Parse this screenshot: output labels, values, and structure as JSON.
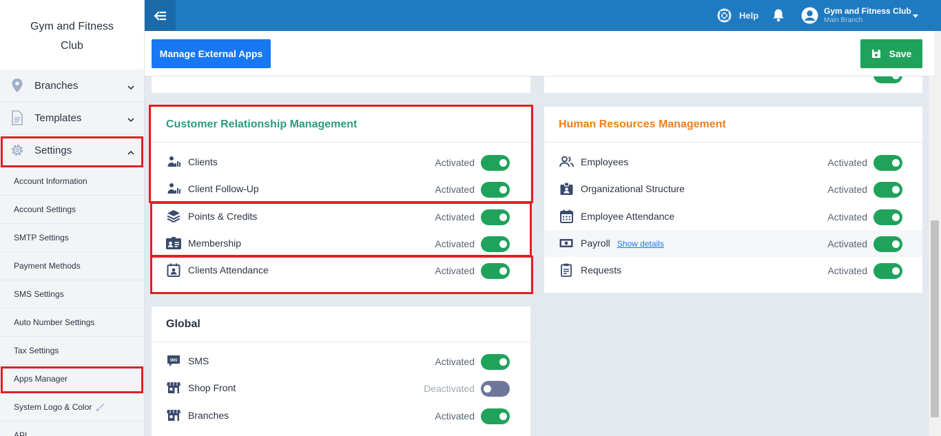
{
  "sidebar": {
    "brand": "Gym and Fitness Club",
    "nav": [
      {
        "label": "Branches"
      },
      {
        "label": "Templates"
      },
      {
        "label": "Settings"
      }
    ],
    "settings_items": [
      {
        "label": "Account Information"
      },
      {
        "label": "Account Settings"
      },
      {
        "label": "SMTP Settings"
      },
      {
        "label": "Payment Methods"
      },
      {
        "label": "SMS Settings"
      },
      {
        "label": "Auto Number Settings"
      },
      {
        "label": "Tax Settings"
      },
      {
        "label": "Apps Manager"
      },
      {
        "label": "System Logo & Color"
      },
      {
        "label": "API"
      }
    ]
  },
  "topbar": {
    "help_label": "Help",
    "user_name": "Gym and Fitness Club",
    "user_branch": "Main Branch"
  },
  "actions": {
    "manage_label": "Manage External Apps",
    "save_label": "Save"
  },
  "crm": {
    "title": "Customer Relationship Management",
    "title_color": "#2a9d7c",
    "rows": [
      {
        "label": "Clients",
        "status": "Activated",
        "icon": "client-stats-icon"
      },
      {
        "label": "Client Follow-Up",
        "status": "Activated",
        "icon": "client-stats-icon"
      },
      {
        "label": "Points & Credits",
        "status": "Activated",
        "icon": "layers-icon"
      },
      {
        "label": "Membership",
        "status": "Activated",
        "icon": "id-card-icon"
      },
      {
        "label": "Clients Attendance",
        "status": "Activated",
        "icon": "calendar-user-icon"
      }
    ]
  },
  "hr": {
    "title": "Human Resources Management",
    "title_color": "#f07f1a",
    "rows": [
      {
        "label": "Employees",
        "status": "Activated",
        "icon": "users-icon"
      },
      {
        "label": "Organizational Structure",
        "status": "Activated",
        "icon": "badge-icon"
      },
      {
        "label": "Employee Attendance",
        "status": "Activated",
        "icon": "calendar-icon"
      },
      {
        "label": "Payroll",
        "link": "Show details",
        "status": "Activated",
        "icon": "money-icon"
      },
      {
        "label": "Requests",
        "status": "Activated",
        "icon": "clipboard-icon"
      }
    ]
  },
  "global": {
    "title": "Global",
    "rows": [
      {
        "label": "SMS",
        "status": "Activated",
        "icon": "sms-icon"
      },
      {
        "label": "Shop Front",
        "status": "Deactivated",
        "icon": "store-icon"
      },
      {
        "label": "Branches",
        "status": "Activated",
        "icon": "store-icon"
      }
    ]
  }
}
